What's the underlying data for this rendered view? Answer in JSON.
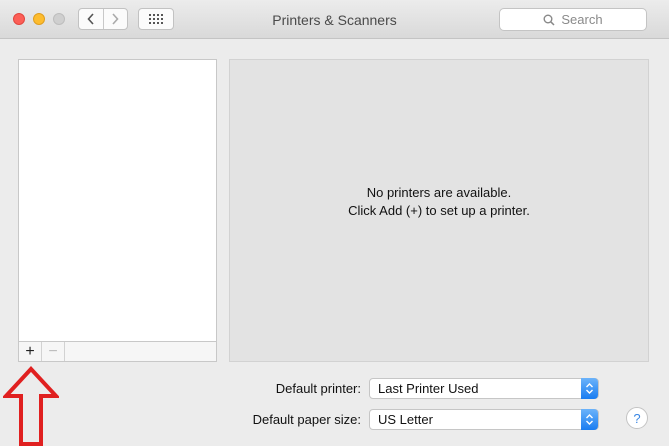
{
  "window": {
    "title": "Printers & Scanners"
  },
  "toolbar": {
    "search_placeholder": "Search",
    "back_icon": "chevron-left-icon",
    "forward_icon": "chevron-right-icon",
    "show_all_icon": "grid-icon"
  },
  "printer_list": {
    "items": [],
    "add_label": "+",
    "remove_label": "−"
  },
  "detail": {
    "message_line1": "No printers are available.",
    "message_line2": "Click Add (+) to set up a printer."
  },
  "settings": {
    "default_printer_label": "Default printer:",
    "default_printer_value": "Last Printer Used",
    "paper_size_label": "Default paper size:",
    "paper_size_value": "US Letter"
  },
  "help": {
    "label": "?"
  },
  "colors": {
    "accent_blue": "#197cf1",
    "annotation_red": "#e02020",
    "close": "#fc5f57",
    "minimize": "#fdbc2e"
  }
}
